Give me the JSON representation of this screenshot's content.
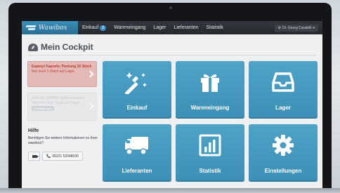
{
  "app": {
    "brand": "Wawibox"
  },
  "nav": {
    "items": [
      {
        "label": "Einkauf",
        "badge": "2"
      },
      {
        "label": "Wareneingang"
      },
      {
        "label": "Lager"
      },
      {
        "label": "Lieferanten"
      },
      {
        "label": "Statistik"
      }
    ],
    "user": "Dr. Georg Caratelli"
  },
  "page": {
    "title": "Mein Cockpit"
  },
  "notices": [
    {
      "title": "Espasyl Kapseln, Packung 20 Stück",
      "text": "Nur noch 1 Stück auf Lager."
    },
    {
      "title": "Artikelnr. 1/00000 Spritzenspitzen",
      "text": "Nur noch 10er Stück auf Lager.",
      "tag": "4 Bestellungen"
    }
  ],
  "help": {
    "title": "Hilfe",
    "text": "Benötigen Sie weitere Informationen zu Ihrer wawibox?",
    "phone": "06221 52048030"
  },
  "tiles": [
    {
      "label": "Einkauf",
      "icon": "magic-wand-icon"
    },
    {
      "label": "Wareneingang",
      "icon": "gift-icon"
    },
    {
      "label": "Lager",
      "icon": "inbox-tray-icon"
    },
    {
      "label": "Lieferanten",
      "icon": "truck-icon"
    },
    {
      "label": "Statistik",
      "icon": "bar-chart-icon"
    },
    {
      "label": "Einstellungen",
      "icon": "gear-icon"
    }
  ],
  "colors": {
    "tile": "#4fa3c7",
    "brand": "#3a8fb8",
    "alert": "#b73b32"
  }
}
